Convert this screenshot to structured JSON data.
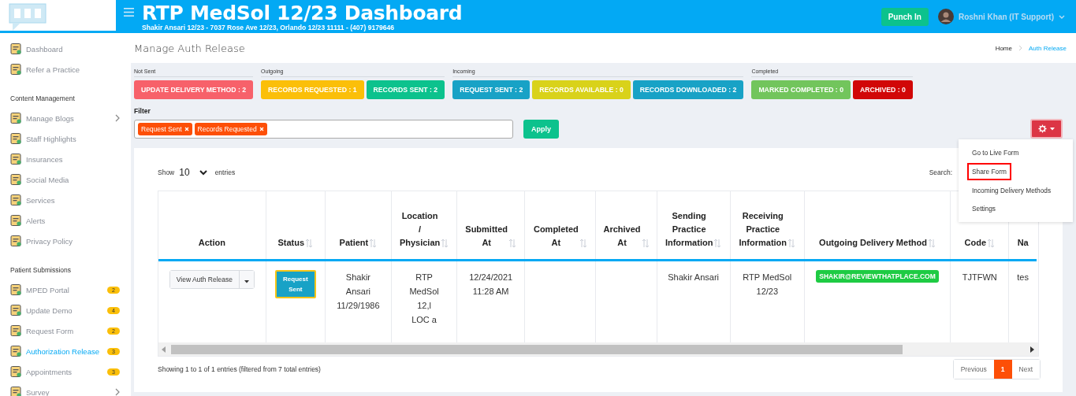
{
  "header": {
    "title": "RTP MedSol 12/23 Dashboard",
    "subtitle": "Shakir Ansari 12/23 - 7037 Rose Ave 12/23, Orlando 12/23 11111 - (407) 9179646",
    "punch_button": "Punch In",
    "user": "Roshni Khan (IT Support)"
  },
  "sidebar": {
    "sections": [
      {
        "items": [
          {
            "label": "Dashboard",
            "selected": false,
            "expandable": false
          },
          {
            "label": "Refer a Practice",
            "selected": false,
            "expandable": false
          }
        ]
      },
      {
        "heading": "Content Management",
        "items": [
          {
            "label": "Manage Blogs",
            "selected": false,
            "expandable": true
          },
          {
            "label": "Staff Highlights",
            "selected": false,
            "expandable": false
          },
          {
            "label": "Insurances",
            "selected": false,
            "expandable": false
          },
          {
            "label": "Social Media",
            "selected": false,
            "expandable": false
          },
          {
            "label": "Services",
            "selected": false,
            "expandable": false
          },
          {
            "label": "Alerts",
            "selected": false,
            "expandable": false
          },
          {
            "label": "Privacy Policy",
            "selected": false,
            "expandable": false
          }
        ]
      },
      {
        "heading": "Patient Submissions",
        "items": [
          {
            "label": "MPED Portal",
            "selected": false,
            "expandable": false,
            "badge": "2"
          },
          {
            "label": "Update Demo",
            "selected": false,
            "expandable": false,
            "badge": "4"
          },
          {
            "label": "Request Form",
            "selected": false,
            "expandable": false,
            "badge": "2"
          },
          {
            "label": "Authorization Release",
            "selected": true,
            "expandable": false,
            "badge": "3"
          },
          {
            "label": "Appointments",
            "selected": false,
            "expandable": false,
            "badge": "3"
          },
          {
            "label": "Survey",
            "selected": false,
            "expandable": true
          }
        ]
      }
    ]
  },
  "page_title": "Manage Auth Release",
  "breadcrumb": [
    {
      "label": "Home",
      "selected": false
    },
    {
      "label": "Auth Release",
      "selected": true
    }
  ],
  "status_groups": [
    {
      "label": "Not Sent",
      "buttons": [
        {
          "label": "UPDATE DELIVERY METHOD : 2",
          "color": "#f7616a"
        }
      ]
    },
    {
      "label": "Outgoing",
      "buttons": [
        {
          "label": "RECORDS REQUESTED : 1",
          "color": "#fbbf09"
        },
        {
          "label": "RECORDS SENT : 2",
          "color": "#0cc28d"
        }
      ]
    },
    {
      "label": "Incoming",
      "buttons": [
        {
          "label": "REQUEST SENT : 2",
          "color": "#18a2c6"
        },
        {
          "label": "RECORDS AVAILABLE : 0",
          "color": "#d9d21a"
        },
        {
          "label": "RECORDS DOWNLOADED : 2",
          "color": "#18a2c6"
        }
      ]
    },
    {
      "label": "Completed",
      "buttons": [
        {
          "label": "MARKED COMPLETED : 0",
          "color": "#72c55c"
        },
        {
          "label": "ARCHIVED : 0",
          "color": "#d10707"
        }
      ]
    }
  ],
  "filter": {
    "label": "Filter",
    "tags": [
      "Request Sent",
      "Records Requested"
    ],
    "apply_button": "Apply"
  },
  "settings_menu": {
    "items": [
      {
        "label": "Go to Live Form",
        "selected": false
      },
      {
        "label": "Share Form",
        "selected": true
      },
      {
        "label": "Incoming Delivery Methods",
        "selected": false
      },
      {
        "label": "Settings",
        "selected": false
      }
    ]
  },
  "table": {
    "length_label_before": "Show",
    "length_value": "10",
    "length_label_after": "entries",
    "search_label": "Search:",
    "columns": [
      {
        "label": "Action",
        "sortable": false
      },
      {
        "label": "Status",
        "sortable": true
      },
      {
        "label": "Patient",
        "sortable": true
      },
      {
        "label": "Location\n/\nPhysician",
        "sortable": true
      },
      {
        "label": "Submitted\nAt",
        "sortable": true
      },
      {
        "label": "Completed\nAt",
        "sortable": true
      },
      {
        "label": "Archived\nAt",
        "sortable": true
      },
      {
        "label": "Sending\nPractice\nInformation",
        "sortable": true
      },
      {
        "label": "Receiving\nPractice\nInformation",
        "sortable": true
      },
      {
        "label": "Outgoing Delivery Method",
        "sortable": true
      },
      {
        "label": "Code",
        "sortable": true
      },
      {
        "label": "Na",
        "sortable": false
      }
    ],
    "rows": [
      {
        "cells": [
          {
            "kind": "split-button",
            "text": "View Auth Release"
          },
          {
            "kind": "badge",
            "text": "Request\nSent",
            "color": "#18a2c6"
          },
          {
            "kind": "text",
            "text": "Shakir\nAnsari\n11/29/1986"
          },
          {
            "kind": "text",
            "text": "RTP\nMedSol\n12,l\nLOC a"
          },
          {
            "kind": "text",
            "text": "12/24/2021\n11:28 AM"
          },
          {
            "kind": "empty"
          },
          {
            "kind": "empty"
          },
          {
            "kind": "text",
            "text": "Shakir Ansari"
          },
          {
            "kind": "text",
            "text": "RTP MedSol\n12/23"
          },
          {
            "kind": "badge",
            "text": "SHAKIR@REVIEWTHATPLACE.COM",
            "color": "#1ecb43"
          },
          {
            "kind": "text",
            "text": "TJTFWN"
          },
          {
            "kind": "text",
            "text": "tes"
          }
        ]
      }
    ],
    "info": "Showing 1 to 1 of 1 entries (filtered from 7 total entries)",
    "pagination": [
      {
        "label": "Previous",
        "selected": false
      },
      {
        "label": "1",
        "selected": true
      },
      {
        "label": "Next",
        "selected": false
      }
    ]
  }
}
